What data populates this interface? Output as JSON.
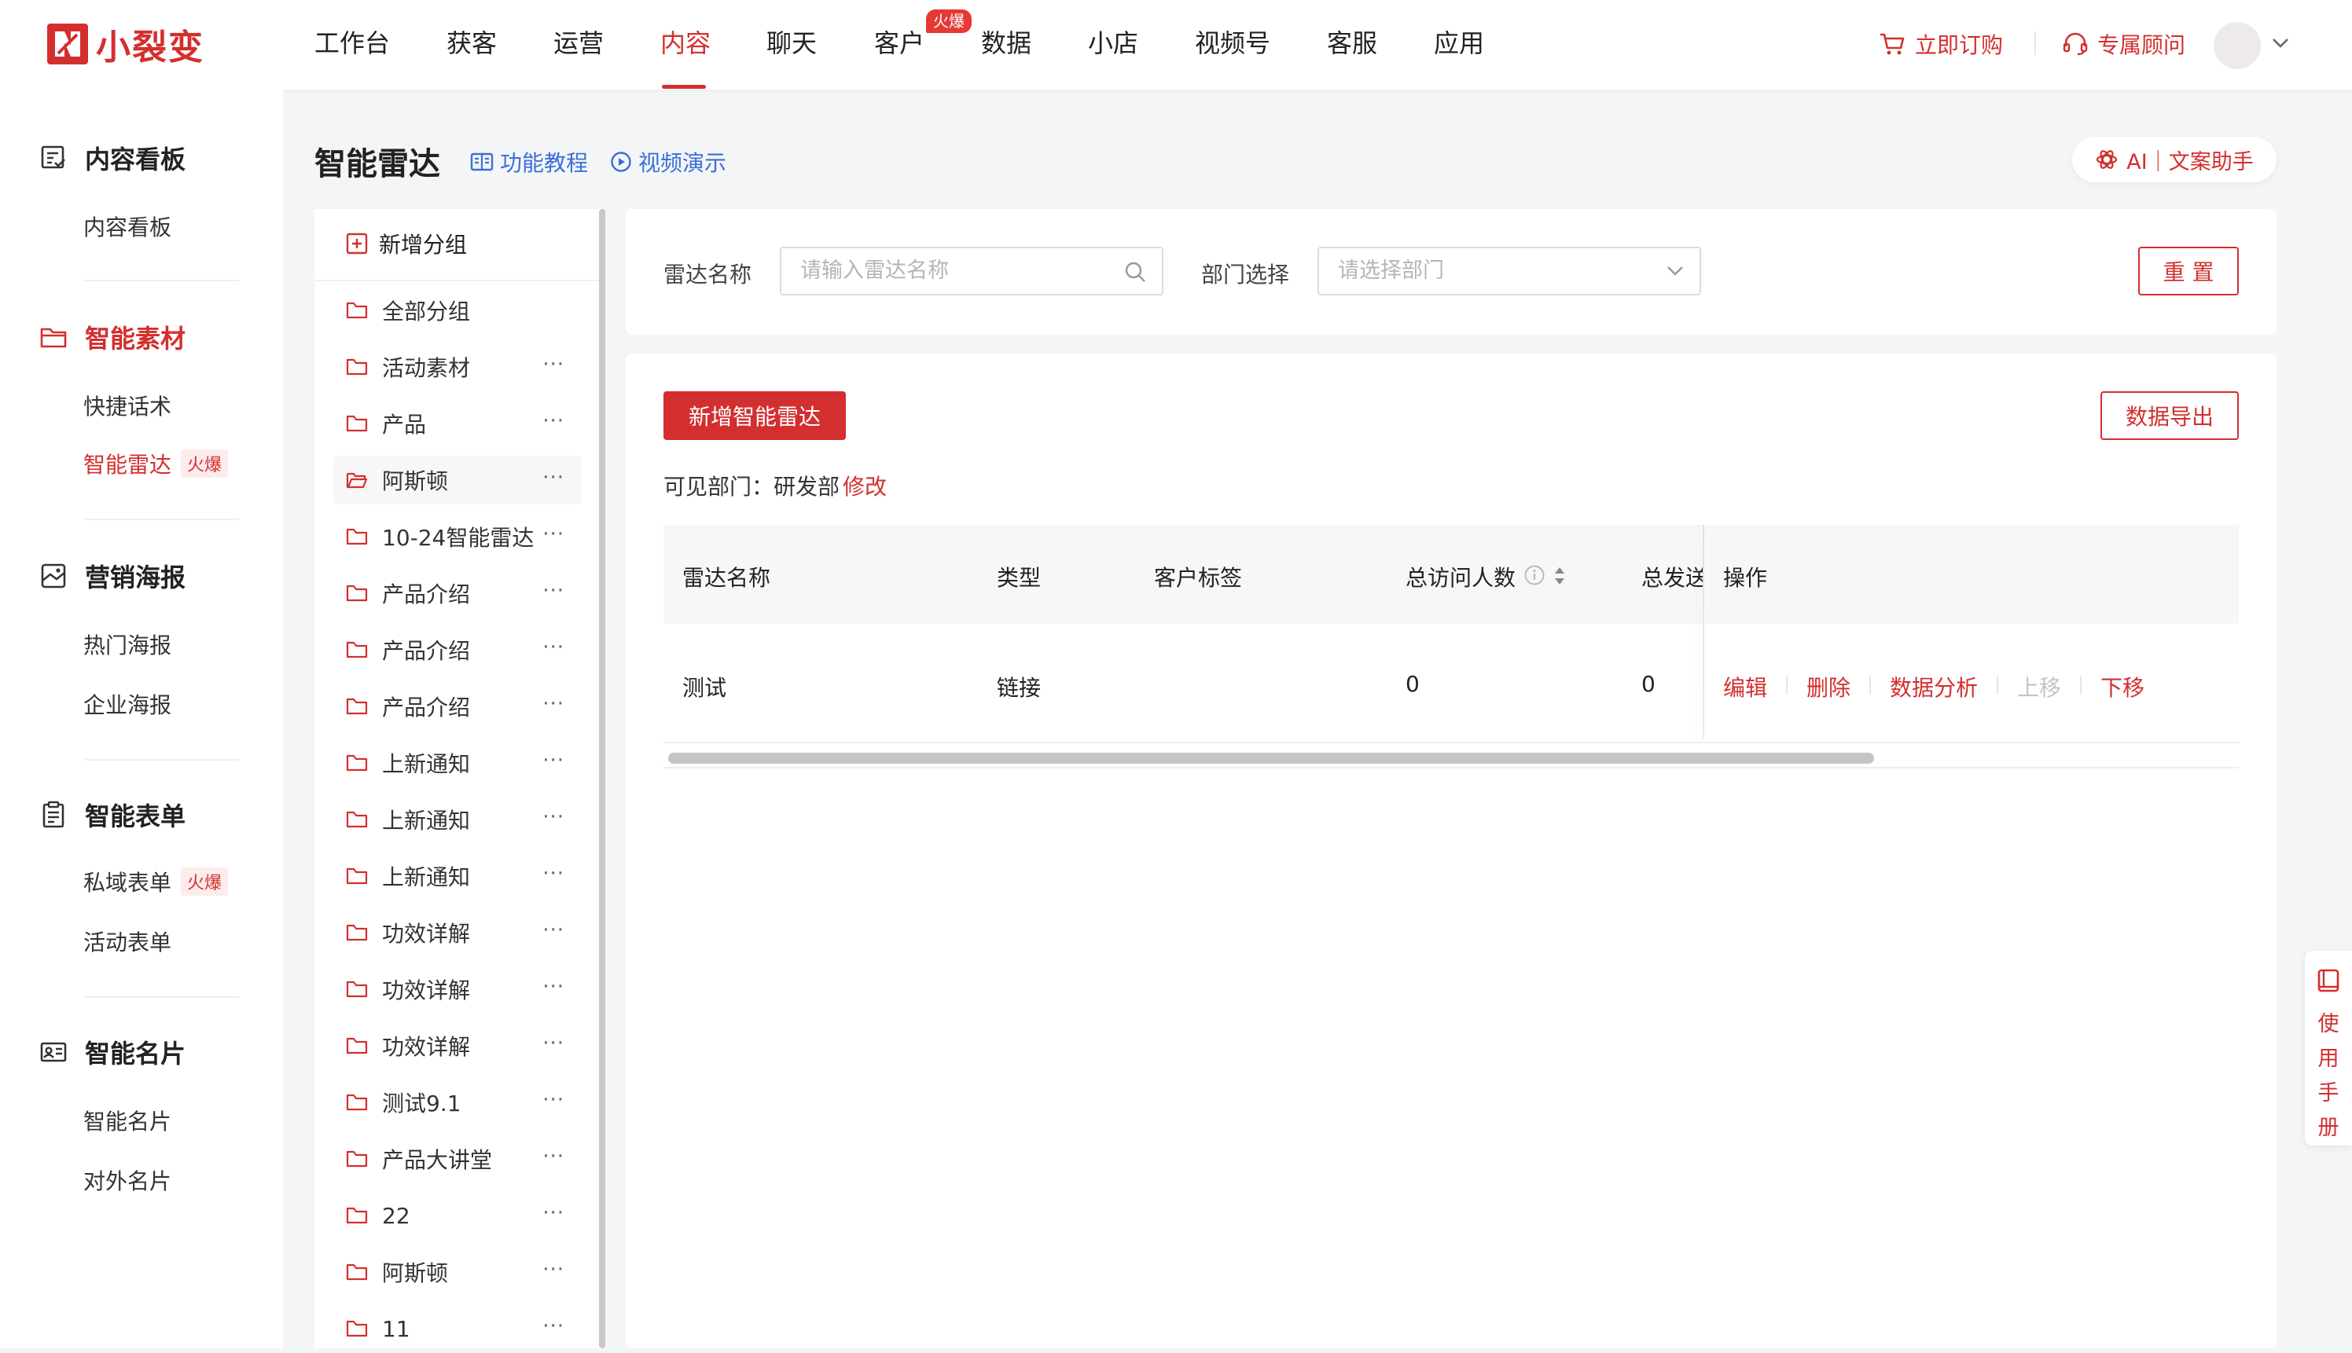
{
  "app": {
    "brand": "小裂变"
  },
  "nav": {
    "items": [
      "工作台",
      "获客",
      "运营",
      "内容",
      "聊天",
      "客户",
      "数据",
      "小店",
      "视频号",
      "客服",
      "应用"
    ],
    "active": "内容",
    "hot_badge": "火爆",
    "order_label": "立即订购",
    "advisor_label": "专属顾问"
  },
  "sidebar": {
    "sections": [
      {
        "title": "内容看板",
        "icon": "dashboard-icon",
        "items": [
          "内容看板"
        ]
      },
      {
        "title": "智能素材",
        "icon": "folder-icon",
        "items": [
          "快捷话术",
          "智能雷达"
        ]
      },
      {
        "title": "营销海报",
        "icon": "poster-icon",
        "items": [
          "热门海报",
          "企业海报"
        ]
      },
      {
        "title": "智能表单",
        "icon": "form-icon",
        "items": [
          "私域表单",
          "活动表单"
        ]
      },
      {
        "title": "智能名片",
        "icon": "card-icon",
        "items": [
          "智能名片",
          "对外名片"
        ]
      }
    ],
    "hot_label": "火爆"
  },
  "page": {
    "title": "智能雷达",
    "tutorial_label": "功能教程",
    "video_label": "视频演示",
    "ai_label": "AI｜文案助手"
  },
  "groups": {
    "add_label": "新增分组",
    "items": [
      "全部分组",
      "活动素材",
      "产品",
      "阿斯顿",
      "10-24智能雷达",
      "产品介绍",
      "产品介绍",
      "产品介绍",
      "上新通知",
      "上新通知",
      "上新通知",
      "功效详解",
      "功效详解",
      "功效详解",
      "测试9.1",
      "产品大讲堂",
      "22",
      "阿斯顿",
      "11"
    ],
    "more": "···"
  },
  "filter": {
    "name_label": "雷达名称",
    "name_placeholder": "请输入雷达名称",
    "dept_label": "部门选择",
    "dept_placeholder": "请选择部门",
    "reset_label": "重 置"
  },
  "actions": {
    "add_label": "新增智能雷达",
    "export_label": "数据导出",
    "visible_dept_prefix": "可见部门：研发部",
    "visible_dept_edit": "修改"
  },
  "table": {
    "columns": [
      "雷达名称",
      "类型",
      "客户标签",
      "总访问人数",
      "总发送",
      "操作"
    ],
    "rows": [
      {
        "name": "测试",
        "type": "链接",
        "tags": "",
        "visitors": "0",
        "sent": "0"
      }
    ],
    "ops": [
      "编辑",
      "删除",
      "数据分析",
      "上移",
      "下移"
    ]
  },
  "manual": {
    "label": "使\n用\n手\n册"
  },
  "colors": {
    "accent": "#d32f2f",
    "link": "#3b6fd6"
  }
}
